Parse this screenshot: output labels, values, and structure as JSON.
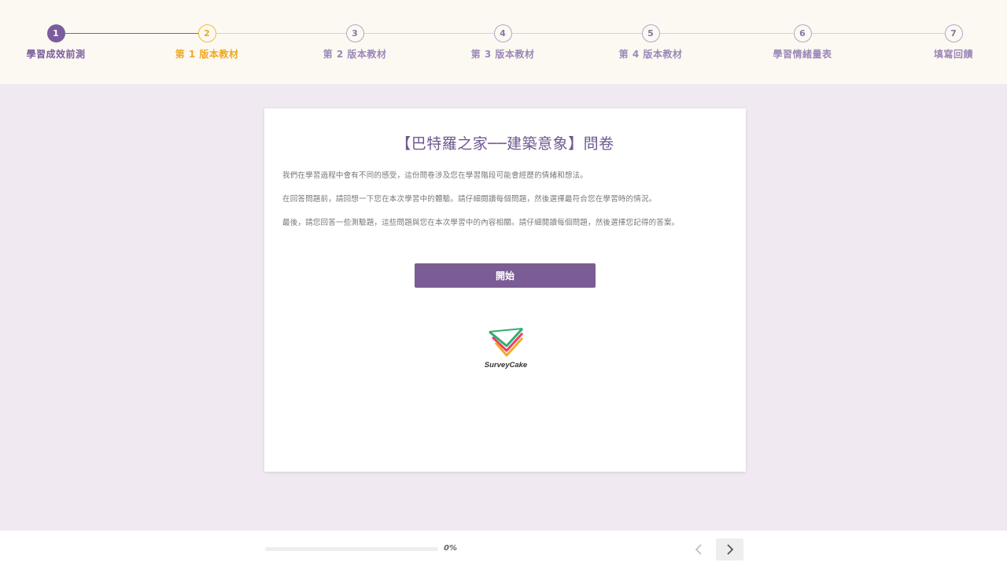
{
  "steps": [
    {
      "number": "1",
      "label": "學習成效前測",
      "state": "done"
    },
    {
      "number": "2",
      "label": "第 1 版本教材",
      "state": "current"
    },
    {
      "number": "3",
      "label": "第 2 版本教材",
      "state": "todo"
    },
    {
      "number": "4",
      "label": "第 3 版本教材",
      "state": "todo"
    },
    {
      "number": "5",
      "label": "第 4 版本教材",
      "state": "todo"
    },
    {
      "number": "6",
      "label": "學習情緒量表",
      "state": "todo"
    },
    {
      "number": "7",
      "label": "填寫回饋",
      "state": "todo"
    }
  ],
  "card": {
    "title": "【巴特羅之家──建築意象】問卷",
    "paragraphs": [
      "我們在學習過程中會有不同的感受，這份問卷涉及您在學習階段可能會經歷的情緒和想法。",
      "在回答問題前，請回想一下您在本次學習中的體驗。請仔細閱讀每個問題，然後選擇最符合您在學習時的情況。",
      "最後，請您回答一些測驗題，這些問題與您在本次學習中的內容相關。請仔細閱讀每個問題，然後選擇您記得的答案。"
    ],
    "start_label": "開始",
    "logo_text": "SurveyCake"
  },
  "footer": {
    "progress_value": 0,
    "progress_text": "0%",
    "prev_icon": "chevron-left-icon",
    "next_icon": "chevron-right-icon"
  },
  "colors": {
    "primary": "#7b5c95",
    "current_step": "#f0a823",
    "header_bg": "#fcf9f2",
    "page_bg": "#f0e9f2"
  }
}
